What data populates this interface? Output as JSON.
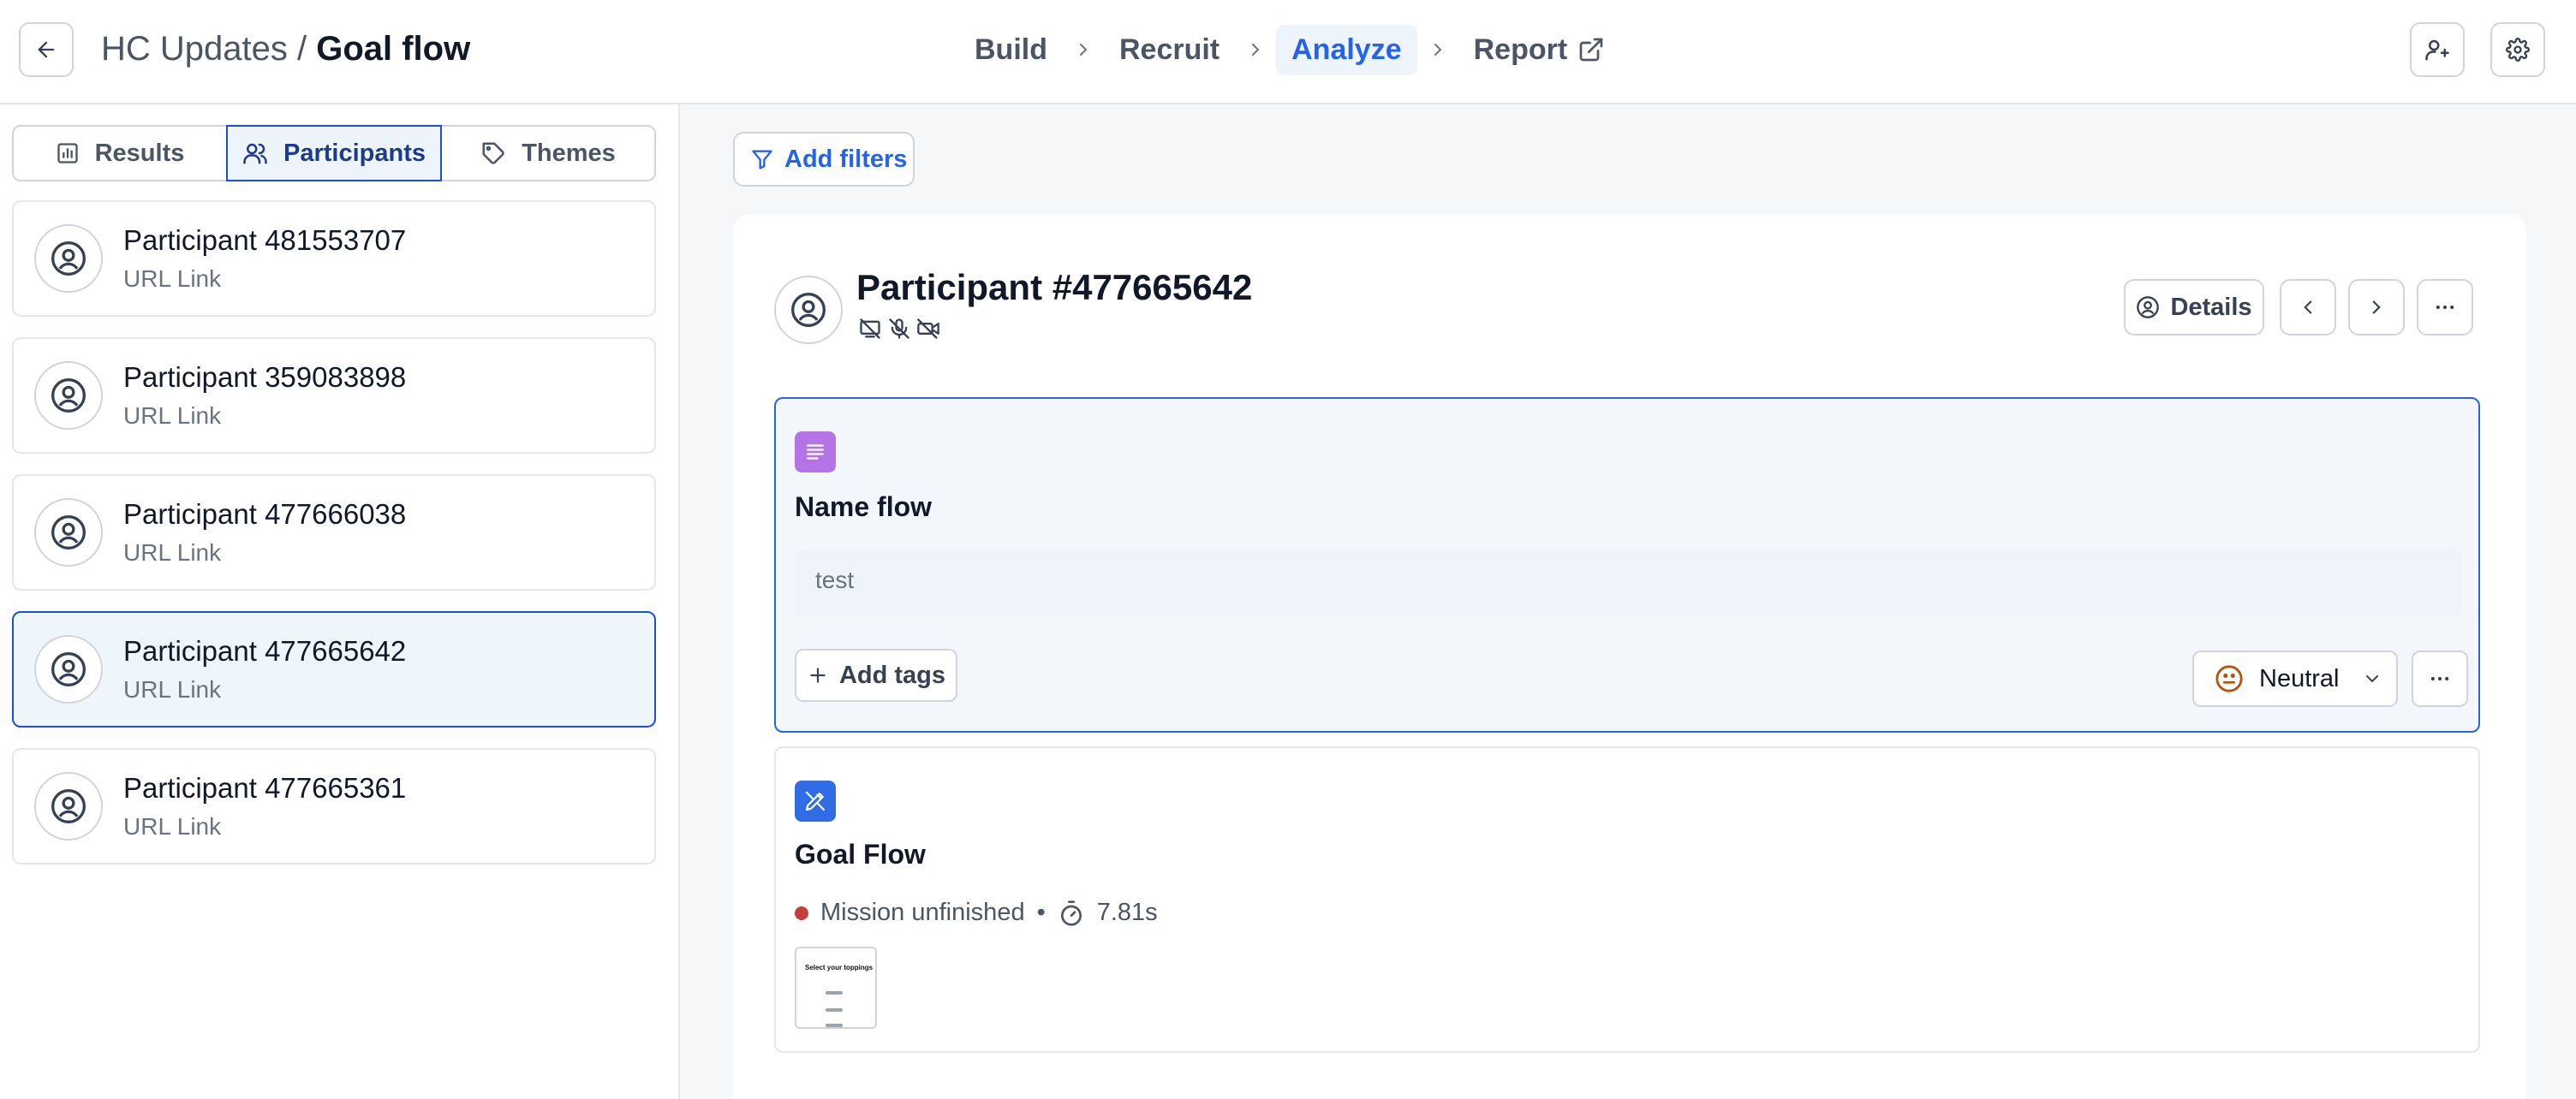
{
  "header": {
    "breadcrumb_parent": "HC Updates",
    "breadcrumb_separator": " / ",
    "title": "Goal flow",
    "steps": [
      "Build",
      "Recruit",
      "Analyze",
      "Report"
    ],
    "active_step": "Analyze"
  },
  "sidebar": {
    "tabs": [
      {
        "label": "Results",
        "icon": "bar-chart-icon"
      },
      {
        "label": "Participants",
        "icon": "users-icon",
        "active": true
      },
      {
        "label": "Themes",
        "icon": "tag-icon"
      }
    ],
    "participants": [
      {
        "name": "Participant 481553707",
        "source": "URL Link"
      },
      {
        "name": "Participant 359083898",
        "source": "URL Link"
      },
      {
        "name": "Participant 477666038",
        "source": "URL Link"
      },
      {
        "name": "Participant 477665642",
        "source": "URL Link",
        "selected": true
      },
      {
        "name": "Participant 477665361",
        "source": "URL Link"
      }
    ]
  },
  "main": {
    "add_filters_label": "Add filters",
    "participant_title": "Participant #477665642",
    "details_label": "Details",
    "blocks": {
      "name_flow": {
        "title": "Name flow",
        "answer": "test",
        "add_tags_label": "Add tags",
        "sentiment": "Neutral"
      },
      "goal_flow": {
        "title": "Goal Flow",
        "status": "Mission unfinished",
        "bullet": "•",
        "duration": "7.81s",
        "thumbnail_title": "Select your toppings"
      }
    }
  },
  "colors": {
    "accent": "#2563eb",
    "selected_bg": "#eef6fc",
    "name_flow_icon": "#b574e5",
    "goal_flow_icon": "#2f6ce5",
    "status_red": "#c53d3d",
    "sentiment_face": "#b45309"
  }
}
